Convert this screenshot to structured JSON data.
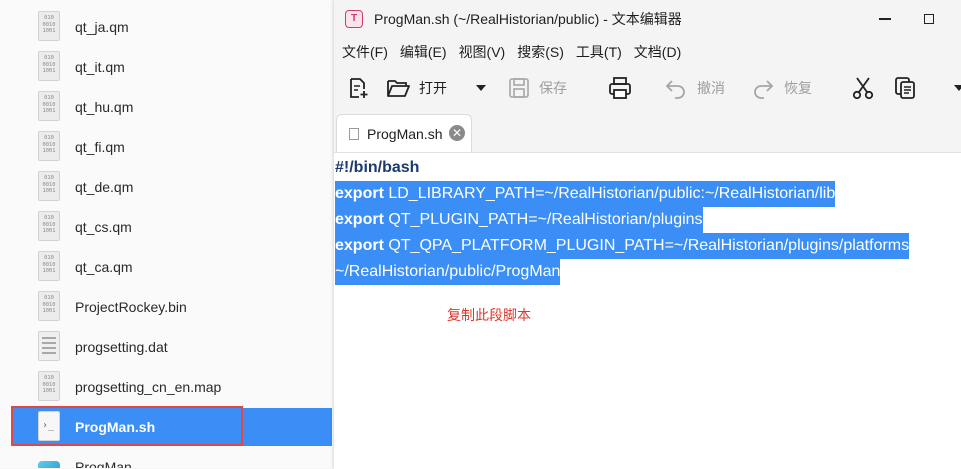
{
  "file_manager": {
    "files": [
      {
        "name": "qt_ja.qm",
        "icon": "binary-file-icon"
      },
      {
        "name": "qt_it.qm",
        "icon": "binary-file-icon"
      },
      {
        "name": "qt_hu.qm",
        "icon": "binary-file-icon"
      },
      {
        "name": "qt_fi.qm",
        "icon": "binary-file-icon"
      },
      {
        "name": "qt_de.qm",
        "icon": "binary-file-icon"
      },
      {
        "name": "qt_cs.qm",
        "icon": "binary-file-icon"
      },
      {
        "name": "qt_ca.qm",
        "icon": "binary-file-icon"
      },
      {
        "name": "ProjectRockey.bin",
        "icon": "binary-file-icon"
      },
      {
        "name": "progsetting.dat",
        "icon": "text-file-icon"
      },
      {
        "name": "progsetting_cn_en.map",
        "icon": "binary-file-icon"
      },
      {
        "name": "ProgMan.sh",
        "icon": "shell-script-icon",
        "selected": true
      },
      {
        "name": "ProgMan",
        "icon": "application-icon"
      }
    ],
    "binary_glyph": [
      "010",
      "0010",
      "1001"
    ]
  },
  "editor_window": {
    "title": "ProgMan.sh (~/RealHistorian/public) - 文本编辑器",
    "app_logo_letter": "T",
    "menu": [
      "文件(F)",
      "编辑(E)",
      "视图(V)",
      "搜索(S)",
      "工具(T)",
      "文档(D)"
    ],
    "toolbar": {
      "open_label": "打开",
      "save_label": "保存",
      "undo_label": "撤消",
      "redo_label": "恢复"
    },
    "tab": {
      "label": "ProgMan.sh",
      "close": "✕"
    },
    "code": {
      "line1": "#!/bin/bash",
      "line2_kw": "export",
      "line2_rest": " LD_LIBRARY_PATH=~/RealHistorian/public:~/RealHistorian/lib",
      "line3_kw": "export",
      "line3_rest": " QT_PLUGIN_PATH=~/RealHistorian/plugins",
      "line4_kw": "export",
      "line4_rest": " QT_QPA_PLATFORM_PLUGIN_PATH=~/RealHistorian/plugins/platforms",
      "line5": "~/RealHistorian/public/ProgMan"
    },
    "annotation": "复制此段脚本"
  },
  "colors": {
    "selection": "#3a8ef6",
    "annotation": "#d93a2e",
    "highlight_frame": "#e04848"
  }
}
